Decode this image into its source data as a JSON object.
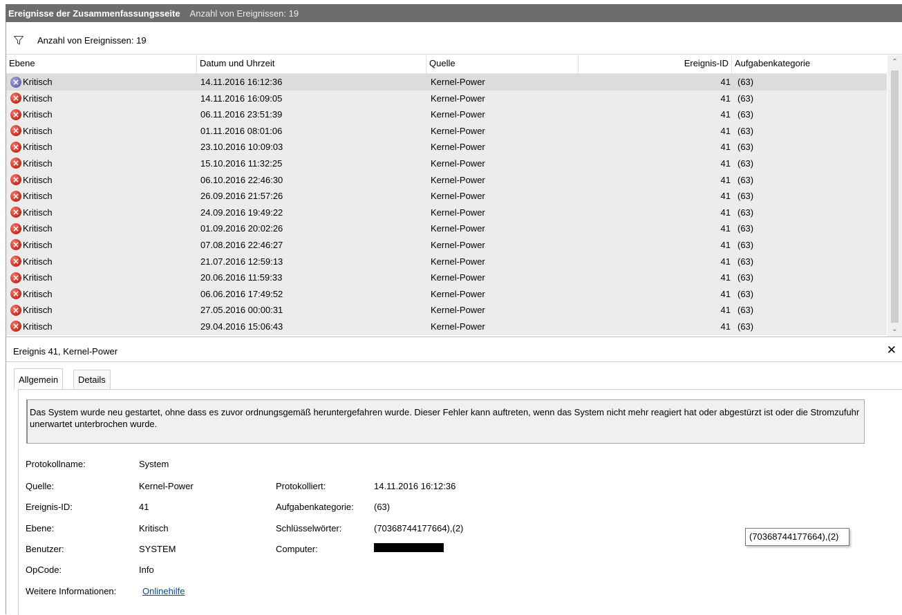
{
  "window": {
    "title": "Ereignisse der Zusammenfassungsseite",
    "subtitle": "Anzahl von Ereignissen: 19"
  },
  "filter": {
    "icon": "filter-icon",
    "count_label": "Anzahl von Ereignissen: 19"
  },
  "table": {
    "columns": [
      "Ebene",
      "Datum und Uhrzeit",
      "Quelle",
      "Ereignis-ID",
      "Aufgabenkategorie"
    ],
    "rows": [
      {
        "level": "Kritisch",
        "date": "14.11.2016 16:12:36",
        "source": "Kernel-Power",
        "id": "41",
        "category": "(63)"
      },
      {
        "level": "Kritisch",
        "date": "14.11.2016 16:09:05",
        "source": "Kernel-Power",
        "id": "41",
        "category": "(63)"
      },
      {
        "level": "Kritisch",
        "date": "06.11.2016 23:51:39",
        "source": "Kernel-Power",
        "id": "41",
        "category": "(63)"
      },
      {
        "level": "Kritisch",
        "date": "01.11.2016 08:01:06",
        "source": "Kernel-Power",
        "id": "41",
        "category": "(63)"
      },
      {
        "level": "Kritisch",
        "date": "23.10.2016 10:09:03",
        "source": "Kernel-Power",
        "id": "41",
        "category": "(63)"
      },
      {
        "level": "Kritisch",
        "date": "15.10.2016 11:32:25",
        "source": "Kernel-Power",
        "id": "41",
        "category": "(63)"
      },
      {
        "level": "Kritisch",
        "date": "06.10.2016 22:46:30",
        "source": "Kernel-Power",
        "id": "41",
        "category": "(63)"
      },
      {
        "level": "Kritisch",
        "date": "26.09.2016 21:57:26",
        "source": "Kernel-Power",
        "id": "41",
        "category": "(63)"
      },
      {
        "level": "Kritisch",
        "date": "24.09.2016 19:49:22",
        "source": "Kernel-Power",
        "id": "41",
        "category": "(63)"
      },
      {
        "level": "Kritisch",
        "date": "01.09.2016 20:02:26",
        "source": "Kernel-Power",
        "id": "41",
        "category": "(63)"
      },
      {
        "level": "Kritisch",
        "date": "07.08.2016 22:46:27",
        "source": "Kernel-Power",
        "id": "41",
        "category": "(63)"
      },
      {
        "level": "Kritisch",
        "date": "21.07.2016 12:59:13",
        "source": "Kernel-Power",
        "id": "41",
        "category": "(63)"
      },
      {
        "level": "Kritisch",
        "date": "20.06.2016 11:59:33",
        "source": "Kernel-Power",
        "id": "41",
        "category": "(63)"
      },
      {
        "level": "Kritisch",
        "date": "06.06.2016 17:49:52",
        "source": "Kernel-Power",
        "id": "41",
        "category": "(63)"
      },
      {
        "level": "Kritisch",
        "date": "27.05.2016 00:00:31",
        "source": "Kernel-Power",
        "id": "41",
        "category": "(63)"
      },
      {
        "level": "Kritisch",
        "date": "29.04.2016 15:06:43",
        "source": "Kernel-Power",
        "id": "41",
        "category": "(63)"
      }
    ],
    "selected_index": 0
  },
  "detail": {
    "title": "Ereignis 41, Kernel-Power",
    "tabs": [
      "Allgemein",
      "Details"
    ],
    "active_tab": "Allgemein",
    "description": "Das System wurde neu gestartet, ohne dass es zuvor ordnungsgemäß heruntergefahren wurde. Dieser Fehler kann auftreten, wenn das System nicht mehr reagiert hat oder abgestürzt ist oder die Stromzufuhr unerwartet unterbrochen wurde.",
    "labels": {
      "log_name": "Protokollname:",
      "source": "Quelle:",
      "event_id": "Ereignis-ID:",
      "level": "Ebene:",
      "user": "Benutzer:",
      "opcode": "OpCode:",
      "more_info": "Weitere Informationen:",
      "logged": "Protokolliert:",
      "task_category": "Aufgabenkategorie:",
      "keywords": "Schlüsselwörter:",
      "computer": "Computer:"
    },
    "values": {
      "log_name": "System",
      "source": "Kernel-Power",
      "event_id": "41",
      "level": "Kritisch",
      "user": "SYSTEM",
      "opcode": "Info",
      "more_info_link": "Onlinehilfe",
      "logged": "14.11.2016 16:12:36",
      "task_category": "(63)",
      "keywords": "(70368744177664),(2)"
    },
    "tooltip": "(70368744177664),(2)"
  }
}
